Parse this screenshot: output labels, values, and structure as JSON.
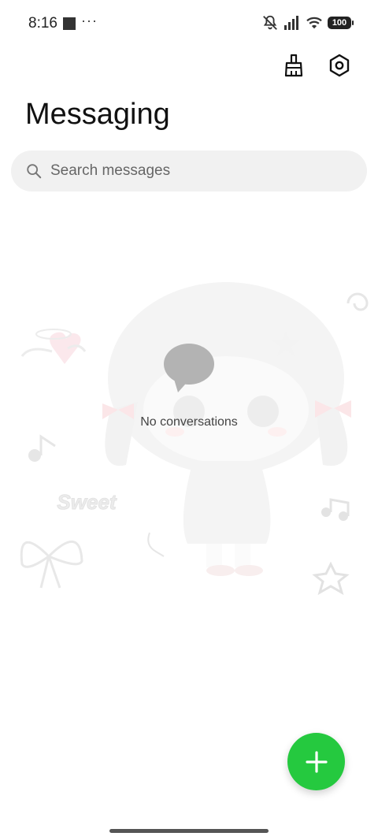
{
  "status_bar": {
    "time": "8:16",
    "more": "···",
    "battery": "100",
    "icons": [
      "notification-square-icon",
      "bell-muted-icon",
      "signal-icon",
      "wifi-icon",
      "battery-icon"
    ]
  },
  "toolbar": {
    "clean_icon": "broom-icon",
    "settings_icon": "settings-hexagon-icon"
  },
  "header": {
    "title": "Messaging"
  },
  "search": {
    "placeholder": "Search messages",
    "value": ""
  },
  "empty_state": {
    "text": "No conversations",
    "watermark_text": "Sweet"
  },
  "fab": {
    "icon": "plus-icon",
    "color": "#25c93f"
  }
}
